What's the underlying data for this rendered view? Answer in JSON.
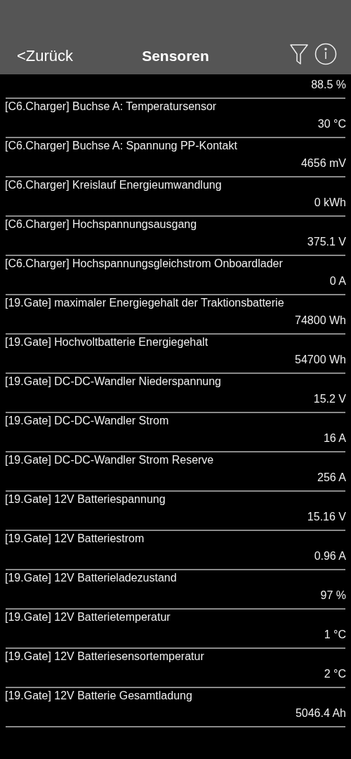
{
  "nav": {
    "back": "<Zurück",
    "title": "Sensoren"
  },
  "rows": [
    {
      "value": "88.5 %"
    },
    {
      "label": "[C6.Charger] Buchse A: Temperatursensor",
      "value": "30 °C"
    },
    {
      "label": "[C6.Charger] Buchse A: Spannung PP-Kontakt",
      "value": "4656 mV"
    },
    {
      "label": "[C6.Charger] Kreislauf Energieumwandlung",
      "value": "0 kWh"
    },
    {
      "label": "[C6.Charger] Hochspannungsausgang",
      "value": "375.1 V"
    },
    {
      "label": "[C6.Charger] Hochspannungsgleichstrom Onboardlader",
      "value": "0 A"
    },
    {
      "label": "[19.Gate] maximaler Energiegehalt der Traktionsbatterie",
      "value": "74800 Wh"
    },
    {
      "label": "[19.Gate] Hochvoltbatterie Energiegehalt",
      "value": "54700 Wh"
    },
    {
      "label": "[19.Gate] DC-DC-Wandler Niederspannung",
      "value": "15.2 V"
    },
    {
      "label": "[19.Gate] DC-DC-Wandler Strom",
      "value": "16 A"
    },
    {
      "label": "[19.Gate] DC-DC-Wandler Strom Reserve",
      "value": "256 A"
    },
    {
      "label": "[19.Gate] 12V Batteriespannung",
      "value": "15.16 V"
    },
    {
      "label": "[19.Gate] 12V Batteriestrom",
      "value": "0.96 A"
    },
    {
      "label": "[19.Gate] 12V Batterieladezustand",
      "value": "97 %"
    },
    {
      "label": "[19.Gate] 12V Batterietemperatur",
      "value": "1 °C"
    },
    {
      "label": "[19.Gate] 12V Batteriesensortemperatur",
      "value": "2 °C"
    },
    {
      "label": "[19.Gate] 12V Batterie Gesamtladung",
      "value": "5046.4 Ah"
    }
  ]
}
